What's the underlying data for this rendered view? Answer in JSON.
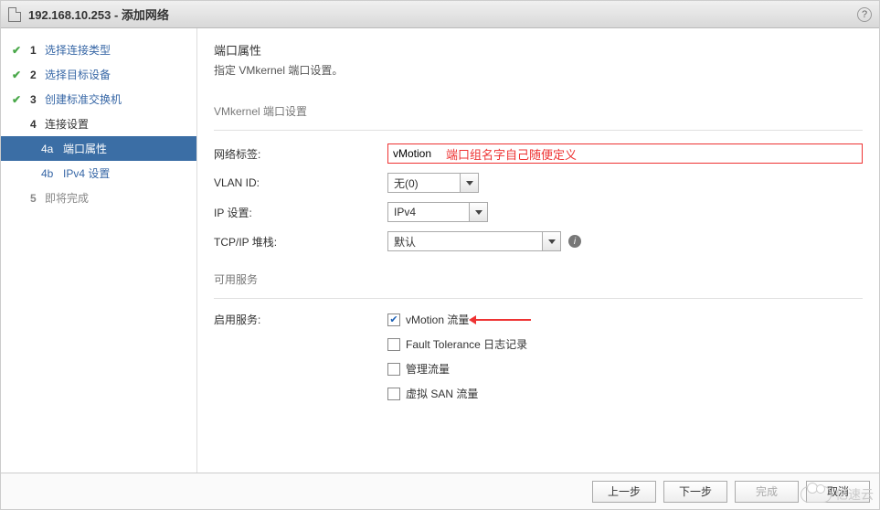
{
  "title": "192.168.10.253 - 添加网络",
  "header": {
    "title": "端口属性",
    "subtitle": "指定 VMkernel 端口设置。"
  },
  "sidebar": {
    "steps": [
      {
        "num": "1",
        "label": "选择连接类型",
        "done": true
      },
      {
        "num": "2",
        "label": "选择目标设备",
        "done": true
      },
      {
        "num": "3",
        "label": "创建标准交换机",
        "done": true
      },
      {
        "num": "4",
        "label": "连接设置",
        "done": false,
        "subs": [
          {
            "num": "4a",
            "label": "端口属性",
            "active": true
          },
          {
            "num": "4b",
            "label": "IPv4 设置",
            "active": false
          }
        ]
      },
      {
        "num": "5",
        "label": "即将完成",
        "pending": true
      }
    ]
  },
  "form": {
    "section1_title": "VMkernel 端口设置",
    "net_label_lbl": "网络标签:",
    "net_label_value": "vMotion",
    "net_label_annot": "端口组名字自己随便定义",
    "vlan_lbl": "VLAN ID:",
    "vlan_value": "无(0)",
    "ip_lbl": "IP 设置:",
    "ip_value": "IPv4",
    "tcpip_lbl": "TCP/IP 堆栈:",
    "tcpip_value": "默认",
    "section2_title": "可用服务",
    "enable_lbl": "启用服务:",
    "services": [
      {
        "label": "vMotion 流量",
        "checked": true,
        "arrow": true
      },
      {
        "label": "Fault Tolerance 日志记录",
        "checked": false
      },
      {
        "label": "管理流量",
        "checked": false
      },
      {
        "label": "虚拟 SAN 流量",
        "checked": false
      }
    ]
  },
  "footer": {
    "back": "上一步",
    "next": "下一步",
    "finish": "完成",
    "cancel": "取消"
  },
  "watermark": "亿速云"
}
